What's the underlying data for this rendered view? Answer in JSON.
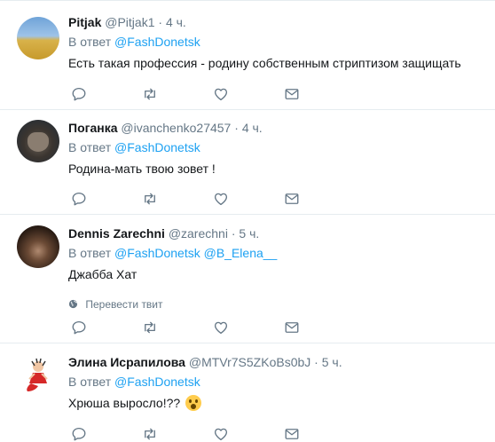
{
  "tweets": [
    {
      "name": "Pitjak",
      "handle": "@Pitjak1",
      "sep": "·",
      "time": "4 ч.",
      "reply_prefix": "В ответ",
      "reply_to": [
        "@FashDonetsk"
      ],
      "text": "Есть такая профессия - родину собственным стриптизом защищать"
    },
    {
      "name": "Поганка",
      "handle": "@ivanchenko27457",
      "sep": "·",
      "time": "4 ч.",
      "reply_prefix": "В ответ",
      "reply_to": [
        "@FashDonetsk"
      ],
      "text": "Родина-мать твою зовет !"
    },
    {
      "name": "Dennis Zarechni",
      "handle": "@zarechni",
      "sep": "·",
      "time": "5 ч.",
      "reply_prefix": "В ответ",
      "reply_to": [
        "@FashDonetsk",
        "@B_Elena__"
      ],
      "text": "Джабба Хат",
      "translate_label": "Перевести твит"
    },
    {
      "name": "Элина Исрапилова",
      "handle": "@MTVr7S5ZKoBs0bJ",
      "sep": "·",
      "time": "5 ч.",
      "reply_prefix": "В ответ",
      "reply_to": [
        "@FashDonetsk"
      ],
      "text": "Хрюша выросло!??",
      "emoji": "astonished-face-emoji"
    }
  ],
  "icons": {
    "reply": "reply-icon",
    "retweet": "retweet-icon",
    "like": "like-icon",
    "dm": "direct-message-icon",
    "translate": "globe-icon"
  },
  "colors": {
    "link": "#1da1f2",
    "muted": "#657786",
    "text": "#14171a",
    "divider": "#e6ecf0"
  }
}
